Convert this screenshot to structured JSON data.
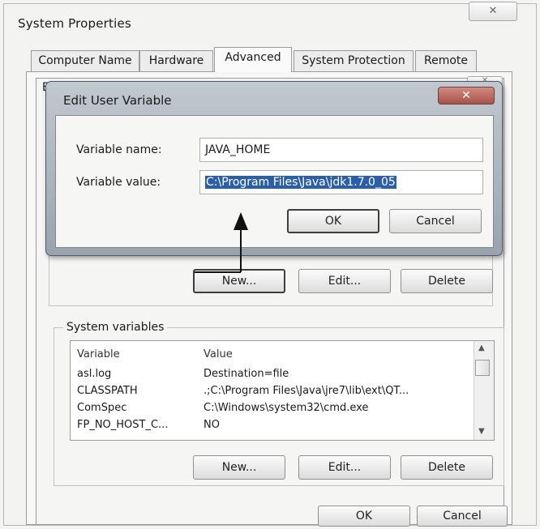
{
  "system_properties": {
    "title": "System Properties",
    "close_label": "✕",
    "tabs": [
      {
        "label": "Computer Name"
      },
      {
        "label": "Hardware"
      },
      {
        "label": "Advanced"
      },
      {
        "label": "System Protection"
      },
      {
        "label": "Remote"
      }
    ],
    "active_tab": "Advanced"
  },
  "environment_variables": {
    "title_stub": "En",
    "close_label": "✕",
    "user_buttons": {
      "new": "New...",
      "edit": "Edit...",
      "delete": "Delete"
    },
    "system_variables_label": "System variables",
    "system_table": {
      "columns": [
        "Variable",
        "Value"
      ],
      "rows": [
        {
          "variable": "asl.log",
          "value": "Destination=file"
        },
        {
          "variable": "CLASSPATH",
          "value": ".;C:\\Program Files\\Java\\jre7\\lib\\ext\\QT..."
        },
        {
          "variable": "ComSpec",
          "value": "C:\\Windows\\system32\\cmd.exe"
        },
        {
          "variable": "FP_NO_HOST_C...",
          "value": "NO"
        }
      ]
    },
    "system_buttons": {
      "new": "New...",
      "edit": "Edit...",
      "delete": "Delete"
    },
    "ok_label": "OK",
    "cancel_label": "Cancel"
  },
  "edit_user_variable": {
    "title": "Edit User Variable",
    "close_label": "✕",
    "name_label": "Variable name:",
    "name_value": "JAVA_HOME",
    "value_label": "Variable value:",
    "value_value": "C:\\Program Files\\Java\\jdk1.7.0_05",
    "ok_label": "OK",
    "cancel_label": "Cancel"
  },
  "icons": {
    "close": "close-icon",
    "scroll_up": "scroll-up-icon",
    "scroll_down": "scroll-down-icon",
    "annotation_arrow": "arrow-icon"
  },
  "colors": {
    "selection": "#2b5ea8",
    "edit_frame": "#9aa3ad",
    "close_button": "#a9524a"
  }
}
